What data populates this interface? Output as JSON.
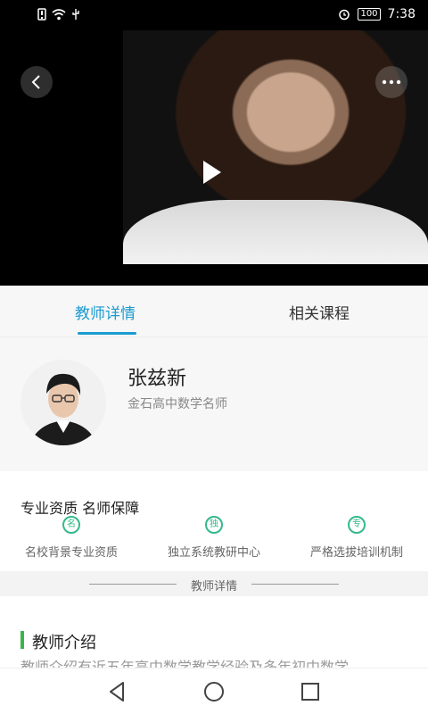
{
  "status_bar": {
    "battery": "100",
    "time": "7:38"
  },
  "video": {
    "back_icon": "chevron-left",
    "more_icon": "more-horizontal",
    "play_icon": "play"
  },
  "tabs": [
    {
      "label": "教师详情",
      "active": true
    },
    {
      "label": "相关课程",
      "active": false
    }
  ],
  "teacher": {
    "name": "张兹新",
    "title": "金石高中数学名师"
  },
  "qualifications": {
    "title": "专业资质 名师保障",
    "items": [
      {
        "badge": "名",
        "label": "名校背景专业资质"
      },
      {
        "badge": "独",
        "label": "独立系统教研中心"
      },
      {
        "badge": "专",
        "label": "严格选拔培训机制"
      }
    ]
  },
  "divider": {
    "label": "教师详情"
  },
  "intro": {
    "title": "教师介绍",
    "text": "教师介绍有近五年高中数学教学经验及多年初中数学"
  },
  "colors": {
    "accent": "#1a9bcf",
    "green": "#35b98a",
    "intro_bar": "#3bb54a"
  }
}
